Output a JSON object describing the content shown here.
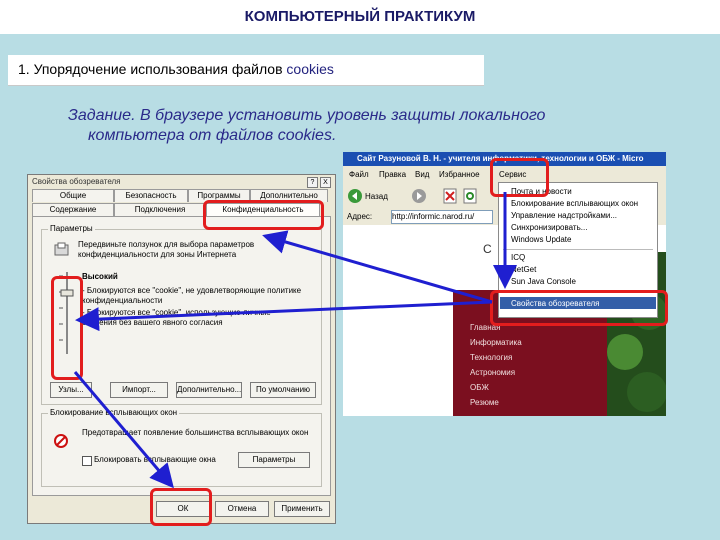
{
  "header": {
    "title": "КОМПЬЮТЕРНЫЙ ПРАКТИКУМ"
  },
  "section": {
    "prefix": "1. Упорядочение использования файлов ",
    "keyword": "cookies"
  },
  "task": {
    "line1": "Задание. В браузере установить уровень защиты локального",
    "line2": "компьютера от файлов cookies."
  },
  "dialog": {
    "title": "Свойства обозревателя",
    "title_buttons": [
      "?",
      "X"
    ],
    "tabs_row1": [
      "Общие",
      "Безопасность",
      "Программы",
      "Дополнительно"
    ],
    "tabs_row2": [
      "Содержание",
      "Подключения",
      "Конфиденциальность"
    ],
    "params_group": "Параметры",
    "params_hint": "Передвиньте ползунок для выбора параметров конфиденциальности для зоны Интернета",
    "level": "Высокий",
    "bullets": [
      "- Блокируются все \"cookie\", не удовлетворяющие политике конфиденциальности",
      "- Блокируются все \"cookie\", использующие личные сведения без вашего явного согласия"
    ],
    "buttons": [
      "Узлы...",
      "Импорт...",
      "Дополнительно...",
      "По умолчанию"
    ],
    "popup_group": "Блокирование всплывающих окон",
    "popup_text": "Предотвращает появление большинства всплывающих окон",
    "popup_checkbox": "Блокировать всплывающие окна",
    "popup_params": "Параметры",
    "footer": {
      "ok": "ОК",
      "cancel": "Отмена",
      "apply": "Применить"
    }
  },
  "browser": {
    "title": "Сайт Разуновой В. Н. - учителя информатики, технологии и ОБЖ - Micro",
    "menu": [
      "Файл",
      "Правка",
      "Вид",
      "Избранное",
      "Сервис"
    ],
    "toolbar_back": "Назад",
    "address_label": "Адрес:",
    "address_value": "http://informic.narod.ru/",
    "page_nav": [
      "Главная",
      "Информатика",
      "Технология",
      "Астрономия",
      "ОБЖ",
      "Резюме"
    ],
    "service_menu": {
      "items": [
        "Почта и новости",
        "Блокирование всплывающих окон",
        "Управление надстройками...",
        "Синхронизировать...",
        "Windows Update",
        "ICQ",
        "NetGet",
        "Sun Java Console",
        "Свойства обозревателя"
      ]
    }
  },
  "colors": {
    "highlight": "#e21d1d",
    "arrow": "#1f1fd0",
    "dialog_bg": "#ece9d8",
    "xp_blue": "#1b4fb2",
    "maroon": "#7b0f1f"
  }
}
